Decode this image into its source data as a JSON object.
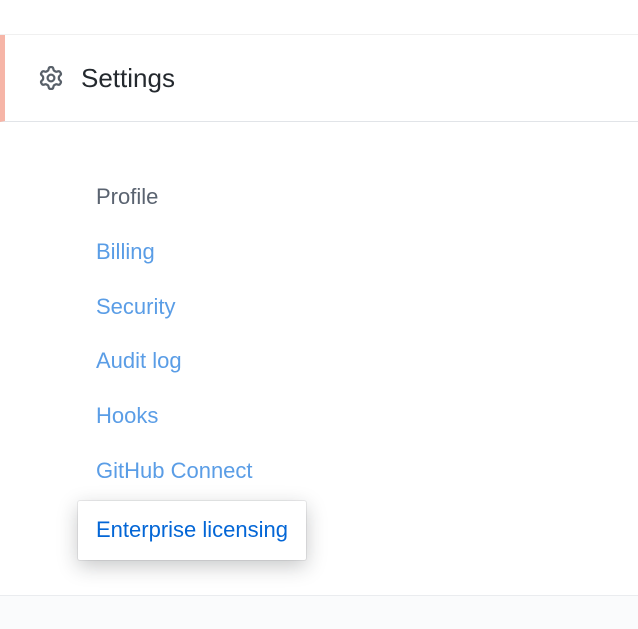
{
  "header": {
    "title": "Settings"
  },
  "nav": {
    "items": [
      {
        "label": "Profile",
        "state": "current"
      },
      {
        "label": "Billing",
        "state": "link"
      },
      {
        "label": "Security",
        "state": "link"
      },
      {
        "label": "Audit log",
        "state": "link"
      },
      {
        "label": "Hooks",
        "state": "link"
      },
      {
        "label": "GitHub Connect",
        "state": "link"
      },
      {
        "label": "Enterprise licensing",
        "state": "highlighted"
      }
    ]
  }
}
